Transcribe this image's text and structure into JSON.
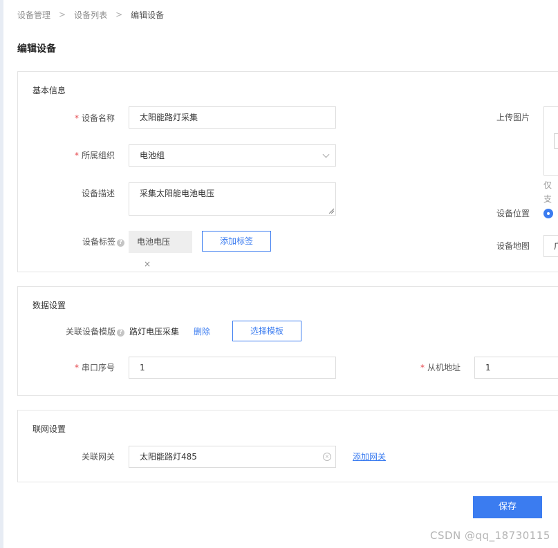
{
  "breadcrumb": {
    "items": [
      "设备管理",
      "设备列表",
      "编辑设备"
    ],
    "separator": ">"
  },
  "page": {
    "title": "编辑设备",
    "watermark": "CSDN @qq_18730115"
  },
  "colors": {
    "primary": "#3b7cf0",
    "required": "#e5484d"
  },
  "basic_info": {
    "title": "基本信息",
    "device_name": {
      "label": "设备名称",
      "required": "*",
      "value": "太阳能路灯采集"
    },
    "organization": {
      "label": "所属组织",
      "required": "*",
      "value": "电池组"
    },
    "description": {
      "label": "设备描述",
      "value": "采集太阳能电池电压"
    },
    "tags": {
      "label": "设备标签",
      "help": "?",
      "items": [
        "电池电压"
      ],
      "remove_icon": "×",
      "add_button": "添加标签"
    },
    "upload_image": {
      "label": "上传图片",
      "hint": "仅支"
    },
    "location": {
      "label": "设备位置"
    },
    "map": {
      "label": "设备地图",
      "value": "广"
    }
  },
  "data_settings": {
    "title": "数据设置",
    "template": {
      "label": "关联设备模版",
      "help": "?",
      "value": "路灯电压采集",
      "delete_link": "删除",
      "select_button": "选择模板"
    },
    "serial_no": {
      "label": "串口序号",
      "required": "*",
      "value": "1"
    },
    "slave_address": {
      "label": "从机地址",
      "required": "*",
      "value": "1"
    }
  },
  "network_settings": {
    "title": "联网设置",
    "gateway": {
      "label": "关联网关",
      "value": "太阳能路灯485",
      "clear_icon": "×",
      "add_link": "添加网关"
    }
  },
  "actions": {
    "save_button": "保存"
  }
}
